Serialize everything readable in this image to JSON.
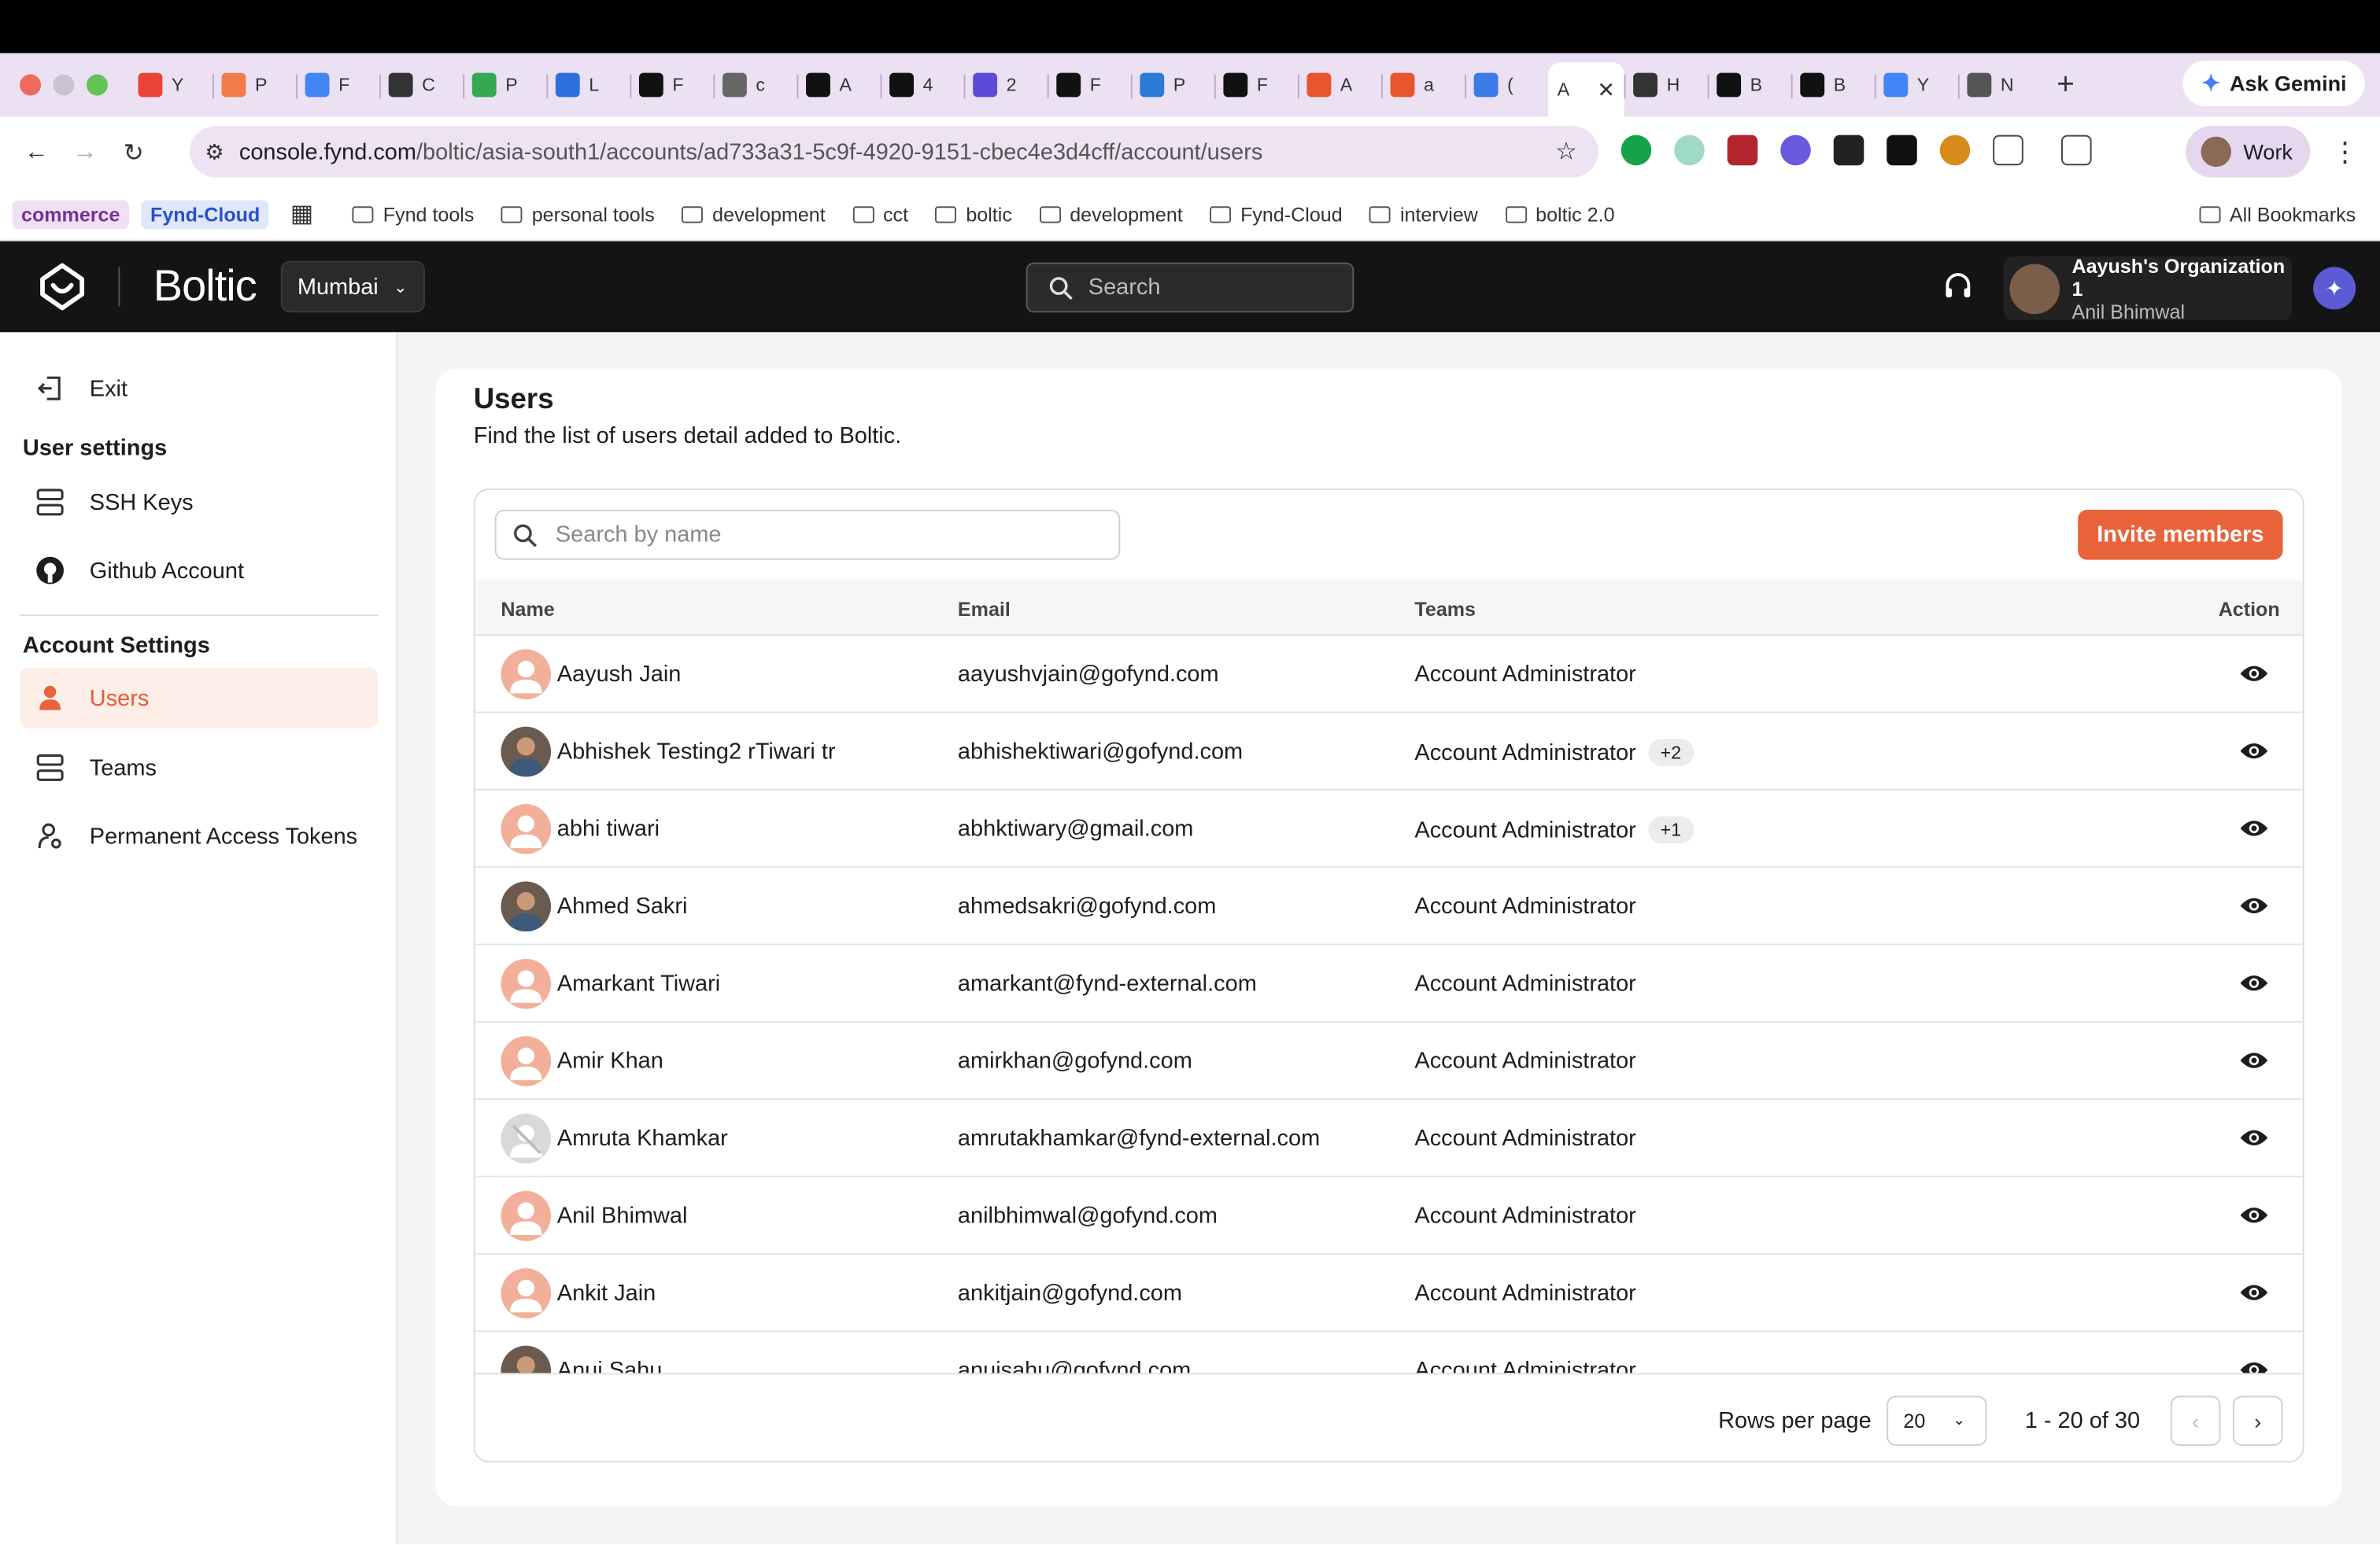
{
  "browser": {
    "tabs": [
      {
        "letter": "Y",
        "icon": "gmail-icon",
        "color": "#ea4335"
      },
      {
        "letter": "P",
        "icon": "ring-icon",
        "color": "#f07c4a"
      },
      {
        "letter": "F",
        "icon": "calendar-icon",
        "color": "#4285f4"
      },
      {
        "letter": "C",
        "icon": "openai-icon",
        "color": "#333333"
      },
      {
        "letter": "P",
        "icon": "sheets-icon",
        "color": "#34a853"
      },
      {
        "letter": "L",
        "icon": "triangle-icon",
        "color": "#2f6fdc"
      },
      {
        "letter": "F",
        "icon": "boltic-icon",
        "color": "#111111"
      },
      {
        "letter": "c",
        "icon": "globe-icon",
        "color": "#666666"
      },
      {
        "letter": "A",
        "icon": "boltic-icon",
        "color": "#111111"
      },
      {
        "letter": "4",
        "icon": "boltic-icon",
        "color": "#111111"
      },
      {
        "letter": "2",
        "icon": "app-icon",
        "color": "#5b4bd6"
      },
      {
        "letter": "F",
        "icon": "boltic-icon",
        "color": "#111111"
      },
      {
        "letter": "P",
        "icon": "azure-icon",
        "color": "#2b7bd6"
      },
      {
        "letter": "F",
        "icon": "boltic-icon",
        "color": "#111111"
      },
      {
        "letter": "A",
        "icon": "bolt-icon",
        "color": "#e8552f"
      },
      {
        "letter": "a",
        "icon": "bolt-icon",
        "color": "#e8552f"
      },
      {
        "letter": "(",
        "icon": "doc-icon",
        "color": "#3b7be8"
      }
    ],
    "active_tab": {
      "letter": "A"
    },
    "tabs_after": [
      {
        "letter": "H",
        "icon": "openai-icon",
        "color": "#333333"
      },
      {
        "letter": "B",
        "icon": "boltic-icon",
        "color": "#111111"
      },
      {
        "letter": "B",
        "icon": "boltic-icon",
        "color": "#111111"
      },
      {
        "letter": "Y",
        "icon": "cloud-icon",
        "color": "#4285f4"
      },
      {
        "letter": "N",
        "icon": "chrome-icon",
        "color": "#555555"
      }
    ],
    "new_tab_label": "+",
    "gemini_label": "Ask Gemini",
    "url_host": "console.fynd.com",
    "url_path": "/boltic/asia-south1/accounts/ad733a31-5c9f-4920-9151-cbec4e3d4cff/account/users",
    "profile_label": "Work",
    "bookmarks": {
      "chips": [
        "commerce",
        "Fynd-Cloud"
      ],
      "folders": [
        "Fynd tools",
        "personal tools",
        "development",
        "cct",
        "boltic",
        "development",
        "Fynd-Cloud",
        "interview",
        "boltic 2.0"
      ],
      "all_label": "All Bookmarks"
    }
  },
  "app": {
    "brand": "Boltic",
    "region": "Mumbai",
    "search_placeholder": "Search",
    "org_name": "Aayush's Organization 1",
    "user_name": "Anil Bhimwal"
  },
  "sidebar": {
    "exit_label": "Exit",
    "user_settings_heading": "User settings",
    "user_items": [
      "SSH Keys",
      "Github Account"
    ],
    "account_settings_heading": "Account Settings",
    "account_items": [
      "Users",
      "Teams",
      "Permanent Access Tokens"
    ],
    "active_item": "Users"
  },
  "page": {
    "title": "Users",
    "subtitle": "Find the list of users detail added to Boltic.",
    "search_placeholder": "Search by name",
    "invite_label": "Invite members",
    "columns": {
      "name": "Name",
      "email": "Email",
      "teams": "Teams",
      "action": "Action"
    },
    "users": [
      {
        "name": "Aayush Jain",
        "email": "aayushvjain@gofynd.com",
        "team": "Account Administrator",
        "more": "",
        "avatar": "placeholder"
      },
      {
        "name": "Abhishek Testing2 rTiwari tr",
        "email": "abhishektiwari@gofynd.com",
        "team": "Account Administrator",
        "more": "+2",
        "avatar": "photo"
      },
      {
        "name": "abhi tiwari",
        "email": "abhktiwary@gmail.com",
        "team": "Account Administrator",
        "more": "+1",
        "avatar": "placeholder"
      },
      {
        "name": "Ahmed Sakri",
        "email": "ahmedsakri@gofynd.com",
        "team": "Account Administrator",
        "more": "",
        "avatar": "photo"
      },
      {
        "name": "Amarkant Tiwari",
        "email": "amarkant@fynd-external.com",
        "team": "Account Administrator",
        "more": "",
        "avatar": "placeholder"
      },
      {
        "name": "Amir Khan",
        "email": "amirkhan@gofynd.com",
        "team": "Account Administrator",
        "more": "",
        "avatar": "placeholder"
      },
      {
        "name": "Amruta Khamkar",
        "email": "amrutakhamkar@fynd-external.com",
        "team": "Account Administrator",
        "more": "",
        "avatar": "gray"
      },
      {
        "name": "Anil Bhimwal",
        "email": "anilbhimwal@gofynd.com",
        "team": "Account Administrator",
        "more": "",
        "avatar": "placeholder"
      },
      {
        "name": "Ankit Jain",
        "email": "ankitjain@gofynd.com",
        "team": "Account Administrator",
        "more": "",
        "avatar": "placeholder"
      },
      {
        "name": "Anuj Sahu",
        "email": "anujsahu@gofynd.com",
        "team": "Account Administrator",
        "more": "",
        "avatar": "photo"
      }
    ],
    "rows_per_page_label": "Rows per page",
    "rows_per_page": "20",
    "range_label": "1 - 20 of 30"
  },
  "colors": {
    "accent": "#e9633b",
    "active_bg": "#fdeee8",
    "avatar_bg": "#f2b09b"
  }
}
